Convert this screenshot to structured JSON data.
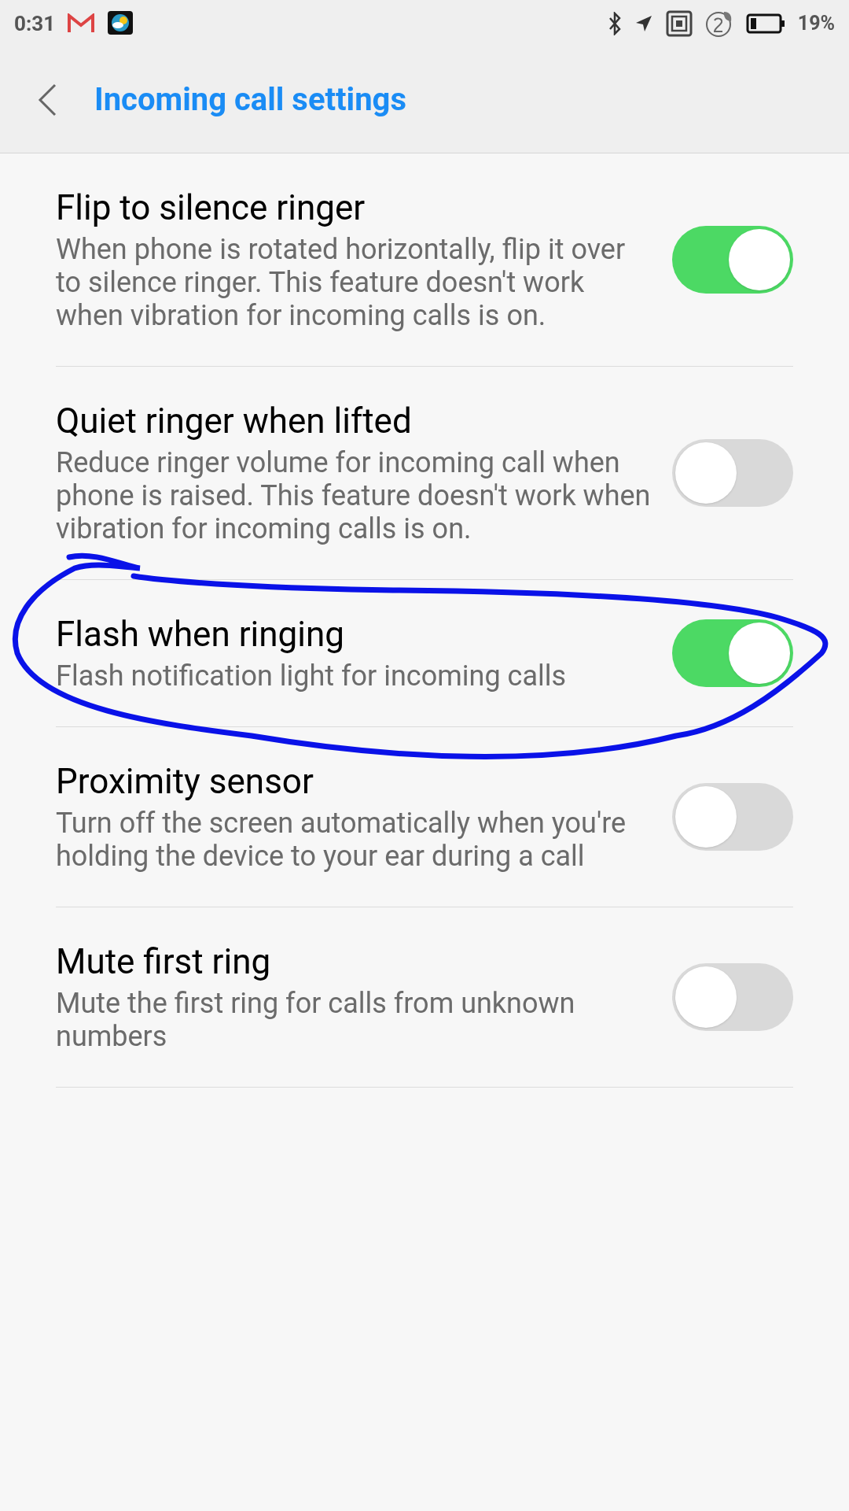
{
  "status_bar": {
    "time": "0:31",
    "battery": "19%"
  },
  "header": {
    "title": "Incoming call settings"
  },
  "settings": [
    {
      "title": "Flip to silence ringer",
      "description": "When phone is rotated horizontally, flip it over to silence ringer. This feature doesn't work when vibration for incoming calls is on.",
      "on": true
    },
    {
      "title": "Quiet ringer when lifted",
      "description": "Reduce ringer volume for incoming call when phone is raised. This feature doesn't work when vibration for incoming calls is on.",
      "on": false
    },
    {
      "title": "Flash when ringing",
      "description": "Flash notification light for incoming calls",
      "on": true
    },
    {
      "title": "Proximity sensor",
      "description": "Turn off the screen automatically when you're holding the device to your ear during a call",
      "on": false
    },
    {
      "title": "Mute first ring",
      "description": "Mute the first ring for calls from unknown numbers",
      "on": false
    }
  ]
}
